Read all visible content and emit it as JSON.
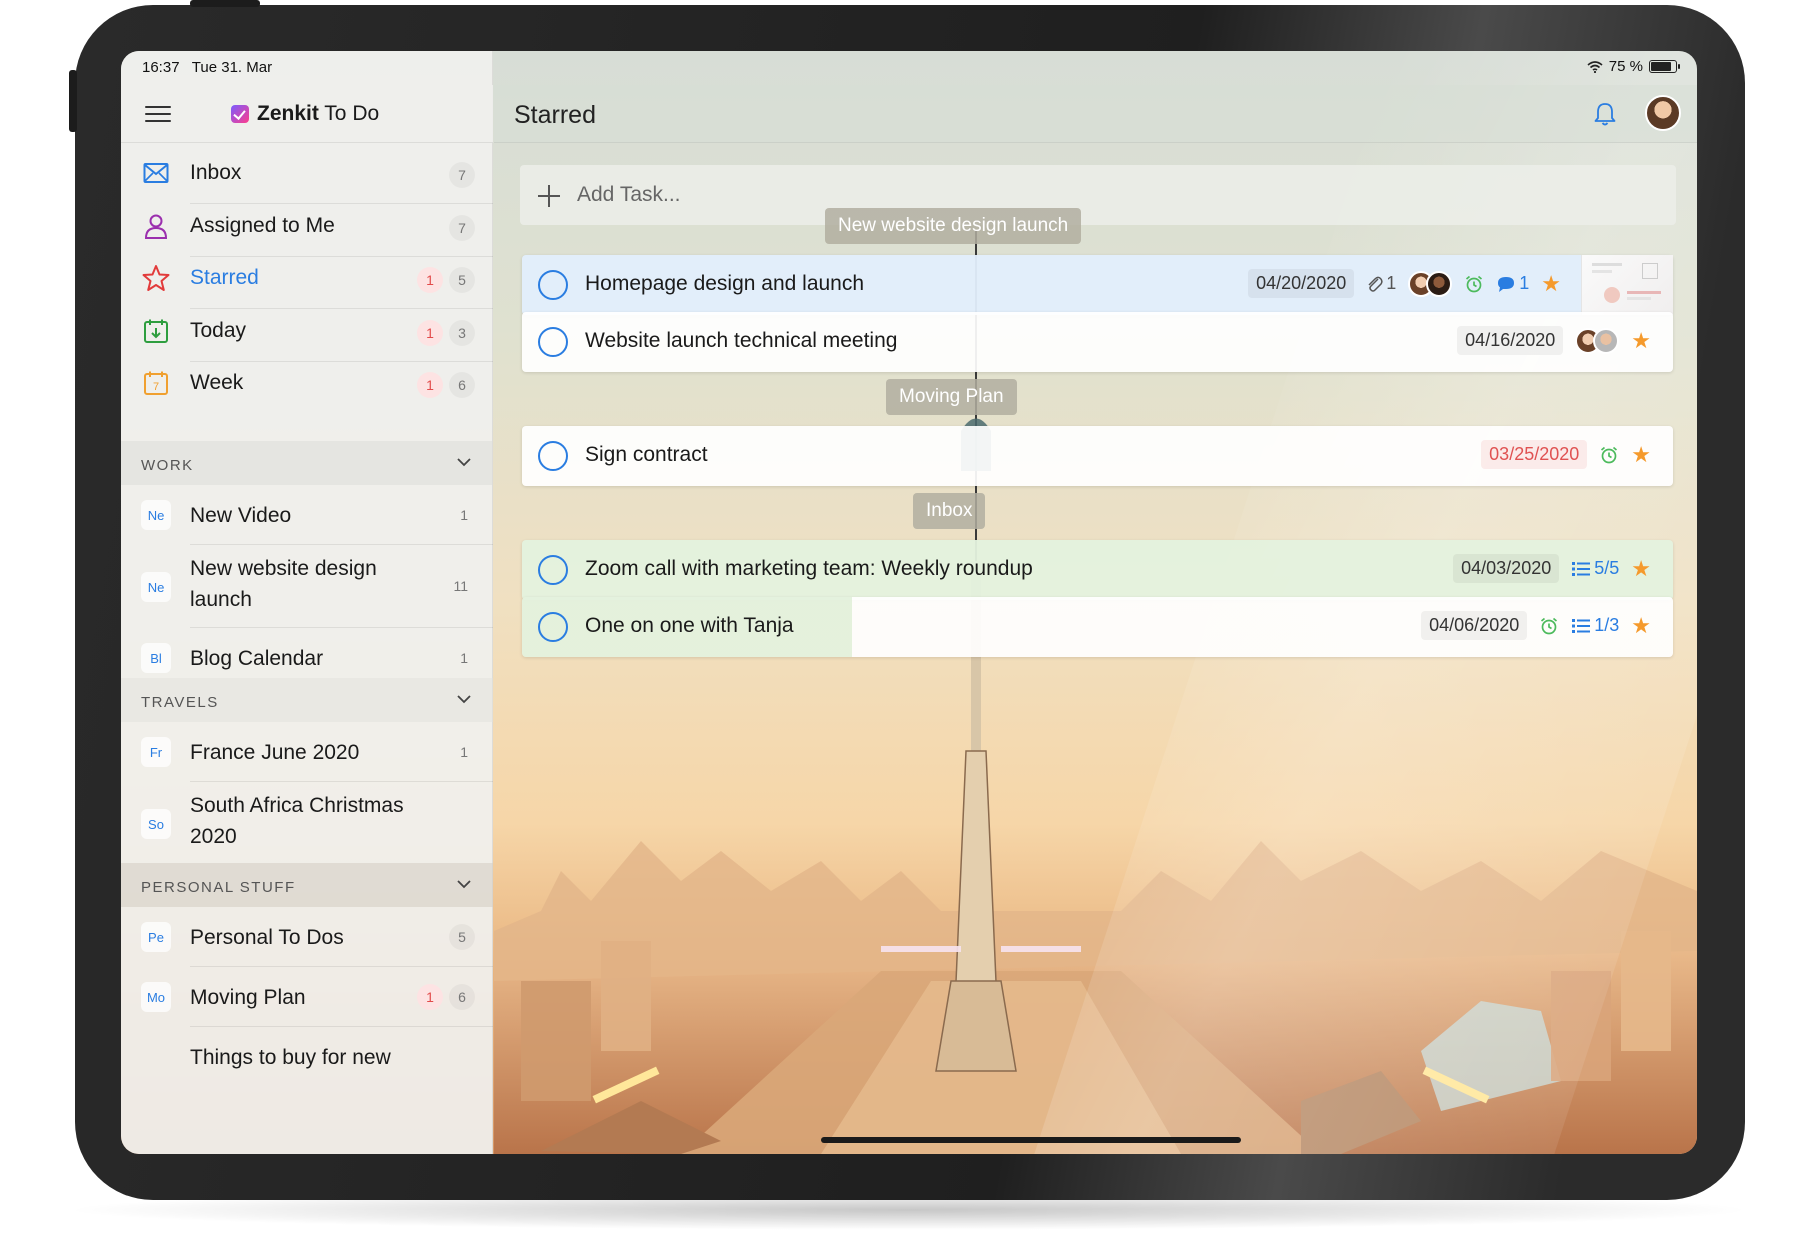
{
  "status": {
    "time": "16:37",
    "date": "Tue 31. Mar",
    "battery": "75 %",
    "battery_level": 0.75
  },
  "app": {
    "brand": "Zenkit",
    "name": " To Do"
  },
  "nav": [
    {
      "label": "Inbox",
      "count": "7",
      "alert": "",
      "icon": "envelope-icon",
      "color": "#2a7de1"
    },
    {
      "label": "Assigned to Me",
      "count": "7",
      "alert": "",
      "icon": "person-icon",
      "color": "#9b2fae"
    },
    {
      "label": "Starred",
      "count": "5",
      "alert": "1",
      "icon": "star-icon",
      "color": "#e23b3b"
    },
    {
      "label": "Today",
      "count": "3",
      "alert": "1",
      "icon": "calendar-today-icon",
      "color": "#2e9e3f"
    },
    {
      "label": "Week",
      "count": "6",
      "alert": "1",
      "icon": "calendar-week-icon",
      "color": "#f0a030"
    }
  ],
  "sections": [
    {
      "title": "WORK",
      "items": [
        {
          "abbr": "Ne",
          "label": "New Video",
          "count": "1"
        },
        {
          "abbr": "Ne",
          "label": "New website design launch",
          "count": "11"
        },
        {
          "abbr": "Bl",
          "label": "Blog Calendar",
          "count": "1"
        }
      ]
    },
    {
      "title": "TRAVELS",
      "items": [
        {
          "abbr": "Fr",
          "label": "France June 2020",
          "count": "1"
        },
        {
          "abbr": "So",
          "label": "South Africa Christmas 2020",
          "count": ""
        }
      ]
    },
    {
      "title": "PERSONAL STUFF",
      "items": [
        {
          "abbr": "Pe",
          "label": "Personal To Dos",
          "count": "5",
          "alert": ""
        },
        {
          "abbr": "Mo",
          "label": "Moving Plan",
          "count": "6",
          "alert": "1"
        },
        {
          "abbr": "",
          "label": "Things to buy for new",
          "count": ""
        }
      ]
    }
  ],
  "main": {
    "title": "Starred",
    "add_placeholder": "Add Task...",
    "groups": [
      {
        "label": "New website design launch"
      },
      {
        "label": "Moving Plan"
      },
      {
        "label": "Inbox"
      }
    ],
    "tasks": [
      {
        "title": "Homepage design and launch",
        "date": "04/20/2020",
        "attachments": "1",
        "comments": "1",
        "starred": true
      },
      {
        "title": "Website launch technical meeting",
        "date": "04/16/2020",
        "starred": true
      },
      {
        "title": "Sign contract",
        "date": "03/25/2020",
        "overdue": true,
        "starred": true
      },
      {
        "title": "Zoom call with marketing team: Weekly roundup",
        "date": "04/03/2020",
        "checklist": "5/5",
        "starred": true
      },
      {
        "title": "One on one with Tanja",
        "date": "04/06/2020",
        "checklist": "1/3",
        "starred": true
      }
    ]
  },
  "icons": {
    "star": "★"
  }
}
